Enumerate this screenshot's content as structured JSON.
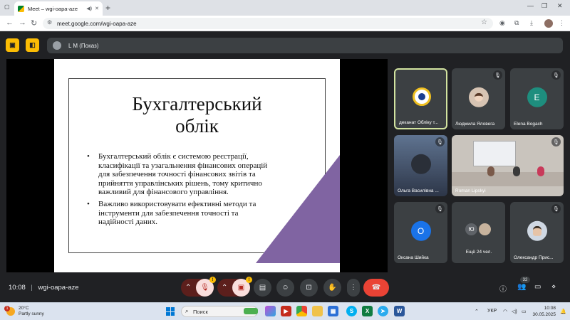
{
  "browser": {
    "tab_title": "Meet – wgi-oapa-aze",
    "new_tab_symbol": "+",
    "url": "meet.google.com/wgi-oapa-aze"
  },
  "meet": {
    "presenter_label": "L M (Показ)",
    "slide": {
      "title_line1": "Бухгалтерський",
      "title_line2": "облік",
      "bullets": [
        "Бухгалтерський облік є системою реєстрації, класифікації та узагальнення фінансових операцій для забезпечення точності фінансових звітів та прийняття управлінських рішень, тому критично важливий для фінансового управління.",
        "Важливо використовувати ефективні методи та інструменти для забезпечення точності та надійності даних."
      ],
      "accent_color": "#8064a2"
    },
    "participants": [
      {
        "name": "деканат Обліку т...",
        "avatar": "logo",
        "active": true
      },
      {
        "name": "Людмила Яловега",
        "avatar": "photo",
        "muted": true
      },
      {
        "name": "Elena Bogach",
        "avatar": "E",
        "avatar_color": "#1e8e7e",
        "muted": true
      },
      {
        "name": "Ольга Василівна ...",
        "avatar": "photo",
        "muted": true
      },
      {
        "name": "Roman Lipskyi",
        "avatar": "video",
        "muted": true
      },
      {
        "name": "Оксана Шийка",
        "avatar": "О",
        "avatar_color": "#1a73e8",
        "muted": true
      },
      {
        "name": "Ещё 24 чел.",
        "avatar": "Ю",
        "avatar_color": "#5f6368"
      },
      {
        "name": "Олександр Прис...",
        "avatar": "photo",
        "muted": true
      }
    ],
    "meeting_time": "10:08",
    "meeting_code": "wgi-oapa-aze",
    "people_count": "32"
  },
  "taskbar": {
    "weather_temp": "20°C",
    "weather_desc": "Partly sunny",
    "weather_badge": "1",
    "search_placeholder": "Поиск",
    "language": "УКР",
    "time": "10:08",
    "date": "30.05.2025"
  }
}
